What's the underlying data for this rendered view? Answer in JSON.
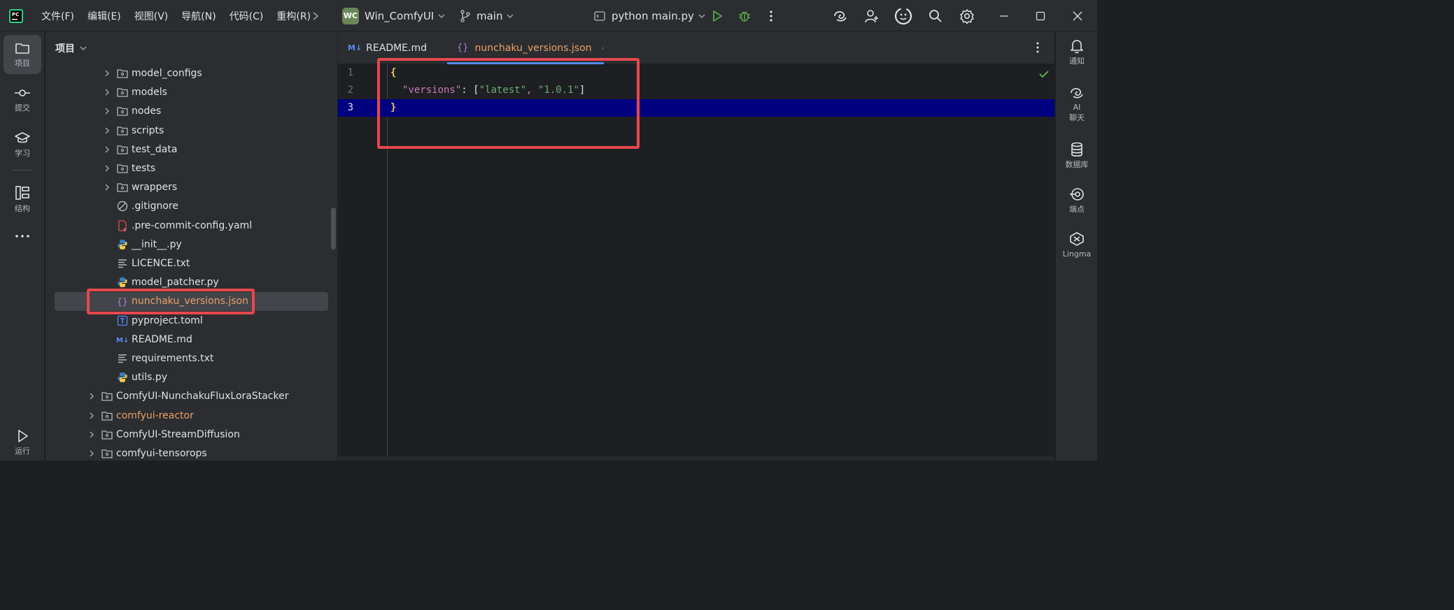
{
  "titlebar": {
    "menus": [
      "文件(F)",
      "编辑(E)",
      "视图(V)",
      "导航(N)",
      "代码(C)",
      "重构(R)"
    ],
    "project_badge": "WC",
    "project_name": "Win_ComfyUI",
    "branch": "main",
    "run_config": "python main.py",
    "colors": {
      "badge_bg": "#6a8759",
      "run": "#57a64a",
      "debug": "#57a64a"
    }
  },
  "leftbar": {
    "items": [
      {
        "label": "项目",
        "icon": "folder-icon"
      },
      {
        "label": "提交",
        "icon": "commit-icon"
      },
      {
        "label": "学习",
        "icon": "graduation-cap-icon"
      },
      {
        "label": "结构",
        "icon": "structure-icon"
      },
      {
        "label": "",
        "icon": "more-icon"
      },
      {
        "label": "运行",
        "icon": "run-icon"
      }
    ]
  },
  "project_panel": {
    "title": "项目",
    "tree": [
      {
        "name": "model_configs",
        "type": "folder"
      },
      {
        "name": "models",
        "type": "folder"
      },
      {
        "name": "nodes",
        "type": "folder"
      },
      {
        "name": "scripts",
        "type": "folder"
      },
      {
        "name": "test_data",
        "type": "folder"
      },
      {
        "name": "tests",
        "type": "folder"
      },
      {
        "name": "wrappers",
        "type": "folder"
      },
      {
        "name": ".gitignore",
        "type": "ignore"
      },
      {
        "name": ".pre-commit-config.yaml",
        "type": "yaml"
      },
      {
        "name": "__init__.py",
        "type": "python"
      },
      {
        "name": "LICENCE.txt",
        "type": "text"
      },
      {
        "name": "model_patcher.py",
        "type": "python"
      },
      {
        "name": "nunchaku_versions.json",
        "type": "json",
        "selected": true
      },
      {
        "name": "pyproject.toml",
        "type": "toml"
      },
      {
        "name": "README.md",
        "type": "markdown"
      },
      {
        "name": "requirements.txt",
        "type": "text"
      },
      {
        "name": "utils.py",
        "type": "python"
      },
      {
        "name": "ComfyUI-NunchakuFluxLoraStacker",
        "type": "folder"
      },
      {
        "name": "comfyui-reactor",
        "type": "folder",
        "highlight": true
      },
      {
        "name": "ComfyUI-StreamDiffusion",
        "type": "folder"
      },
      {
        "name": "comfyui-tensorops",
        "type": "folder"
      }
    ]
  },
  "editor": {
    "tabs": [
      {
        "label": "README.md",
        "badge": "M↓",
        "active": false
      },
      {
        "label": "nunchaku_versions.json",
        "badge": "{}",
        "active": true
      }
    ],
    "line_numbers": [
      "1",
      "2",
      "3"
    ],
    "code": {
      "line1": "{",
      "line2_key": "\"versions\"",
      "line2_colon": ": ",
      "line2_open": "[",
      "line2_v1": "\"latest\"",
      "line2_comma": ", ",
      "line2_v2": "\"1.0.1\"",
      "line2_close": "]",
      "line3": "}"
    },
    "colors": {
      "key": "#c77dbb",
      "string": "#6aab73",
      "brace": "#e8c46a",
      "current_line": "#000080",
      "tab_active": "#e8a06a"
    }
  },
  "rightbar": {
    "items": [
      {
        "label": "通知",
        "icon": "bell-icon"
      },
      {
        "label": "AI\n聊天",
        "icon": "ai-chat-icon"
      },
      {
        "label": "数据库",
        "icon": "database-icon"
      },
      {
        "label": "端点",
        "icon": "endpoints-icon"
      },
      {
        "label": "Lingma",
        "icon": "lingma-icon"
      }
    ]
  }
}
